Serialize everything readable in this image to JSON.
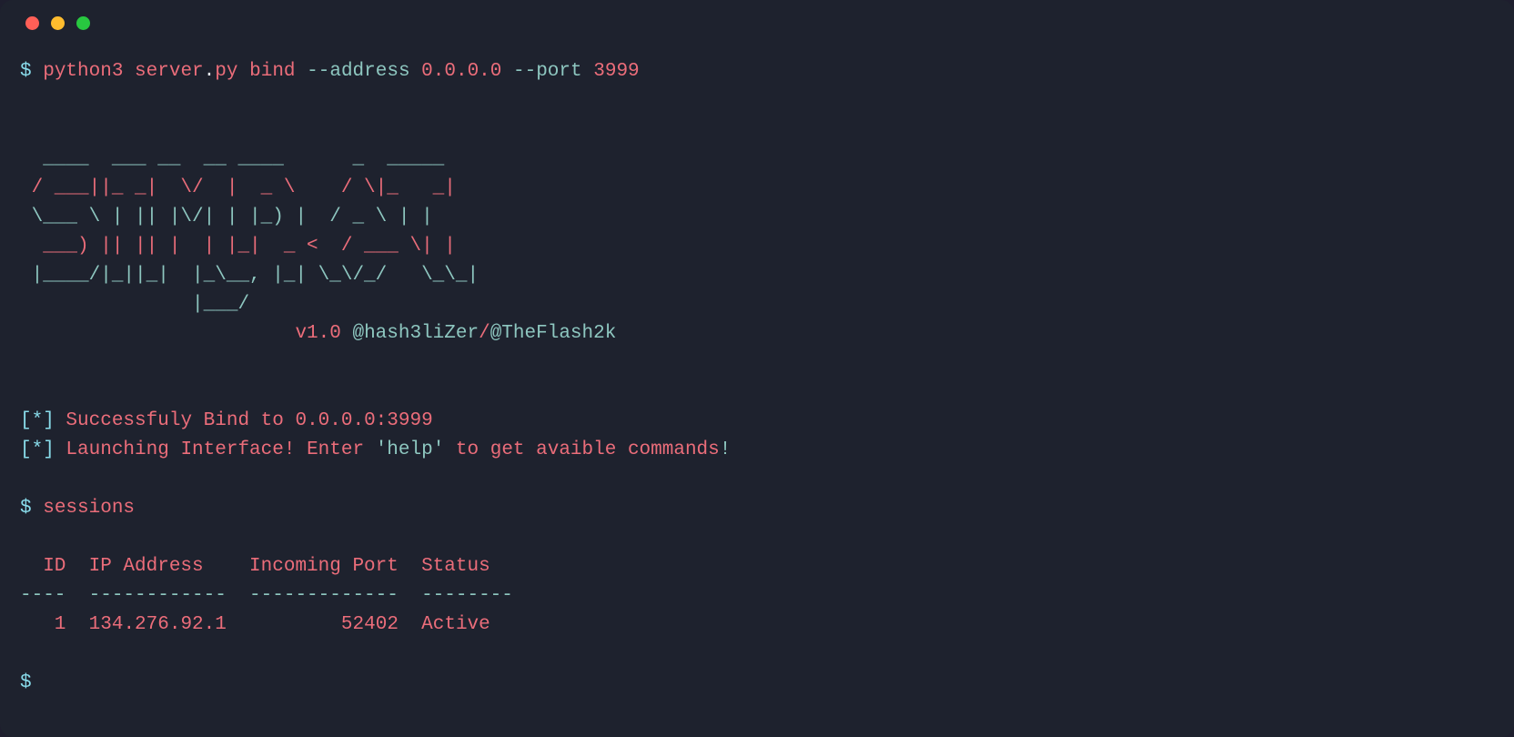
{
  "prompt_char": "$",
  "cmd": {
    "exe": "python3",
    "file": "server",
    "ext": "py",
    "sub": "bind",
    "flag_addr": "--address",
    "addr": "0.0.0.0",
    "flag_port": "--port",
    "port": "3999"
  },
  "ascii_art": "  ____    _____    __  __    ____    _____\n / ___|  |_ _|  |  \\/  |   |  _ \\    / \\|_   _|\n \\___ \\   | |   | |\\/| |  | |_) |  / _ \\  | |  \n  ___) |  | |   | |  | | |_| |   _ <  / ___ \\ | |  \n |____/  |_| |_| |_| \\__,  |_| \\_\\/_/   \\_\\|  \n                    |___/                        ",
  "ascii_row1_a": "  ____  ",
  "ascii_row1_b": " ___ ",
  "ascii_row1_c": " __  __ ",
  "ascii_row1_d": " ____  ",
  "ascii_row1_e": " _ ",
  "ascii_row1_f": " _____ ",
  "ascii_row1": "  ____    ___   __  __     ____        _    _____ ",
  "ascii_banner": {
    "r1": "  ____    ___   __  __     ____        _    _____ ",
    "r2": " / ___|  |_ _| |  \\/  |   |  _ \\      / \\  |_   _|",
    "r3": " \\___ \\   | |  | |\\/| |   | |_) |    / _ \\   | |  ",
    "r4": "  ___) |  | |  | |  | |_  |  _ <    / ___ \\  | |  ",
    "r5": " |____/  |___| |_|  |_\\_, |_| \\_\\_/_/     \\_\\_|  ",
    "r6": "                      |___/                        "
  },
  "banner": {
    "r1": "  ____  ___ __  __ ____      _  _____ ",
    "r2": " / ___||_ _|  \\/  |  _ \\    / \\|_   _|",
    "r3": " \\___ \\ | || |\\/| | |_) |  / _ \\ | |  ",
    "r4": "  ___) || || |  | |_|  _ <  / ___ \\| |  ",
    "r5": " |____/|_||_|  |_\\__, |_| \\_\\/_/   \\_\\_|  ",
    "r6": "               |___/                    "
  },
  "version_prefix": "v1.0 ",
  "author1": "@hash3liZer",
  "author_sep": "/",
  "author2": "@TheFlash2k",
  "status_line1_a": "[*] ",
  "status_line1_b": "Successfuly Bind to ",
  "status_line1_c": "0.0.0.0:3999",
  "status_line2_a": "[*] ",
  "status_line2_b": "Launching Interface! Enter ",
  "status_line2_c": "'help'",
  "status_line2_d": " to get avaible commands",
  "status_line2_e": "!",
  "sessions_cmd": "sessions",
  "table": {
    "header": "  ID  IP Address    Incoming Port  Status  ",
    "rule": "----  ------------  -------------  --------",
    "row_id": "   1",
    "row_ip": "134.276.92.1",
    "row_port": "        52402",
    "row_status": "Active"
  }
}
